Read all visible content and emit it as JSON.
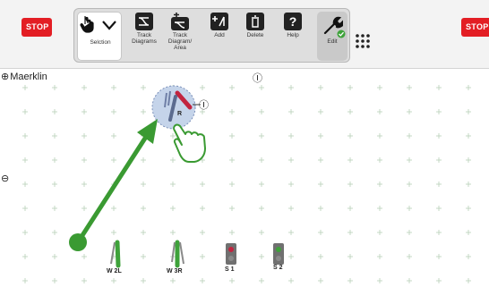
{
  "toolbar": {
    "stop_left": "STOP",
    "stop_right": "STOP",
    "tools": [
      {
        "id": "selection",
        "label": "Selction"
      },
      {
        "id": "track-diagrams",
        "label": "Track\nDiagrams"
      },
      {
        "id": "track-diagram-area",
        "label": "Track\nDiagram/\nArea"
      },
      {
        "id": "add",
        "label": "Add"
      },
      {
        "id": "delete",
        "label": "Delete"
      },
      {
        "id": "help",
        "label": "Help"
      },
      {
        "id": "edit",
        "label": "Edit"
      }
    ]
  },
  "workspace": {
    "name": "Maerklin",
    "plus_symbol": "⊕",
    "minus_symbol": "⊖",
    "info_symbol": "Ⓘ",
    "rotate_label": "R"
  },
  "items": [
    {
      "label": "W 2L"
    },
    {
      "label": "W 3R"
    },
    {
      "label": "S 1"
    },
    {
      "label": "S 2"
    }
  ],
  "colors": {
    "stop": "#e31e24",
    "arrow": "#3a9a32",
    "grid": "#b8d0b8",
    "track_green": "#3ea23a",
    "track_red": "#c2243f"
  }
}
